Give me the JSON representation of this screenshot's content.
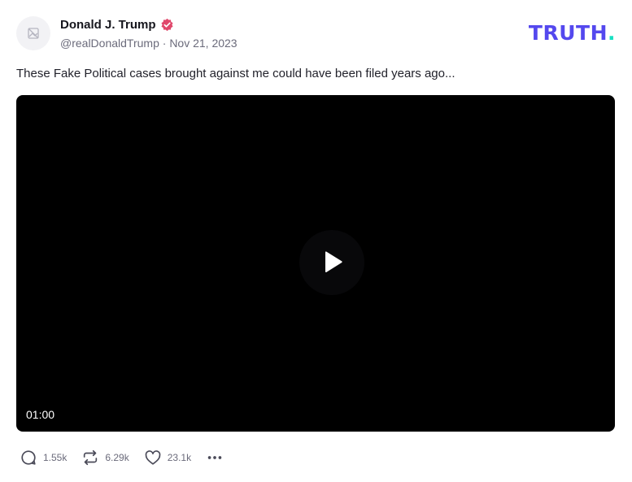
{
  "author": {
    "display_name": "Donald J. Trump",
    "handle": "@realDonaldTrump",
    "separator": "·",
    "date": "Nov 21, 2023"
  },
  "brand": {
    "wordmark": "TRUTH",
    "dot": ".",
    "primary_color": "#5448ee",
    "accent_color": "#17e0c2"
  },
  "post": {
    "text": "These Fake Political cases brought against me could have been filed years ago..."
  },
  "video": {
    "duration": "01:00"
  },
  "actions": {
    "replies": "1.55k",
    "retruths": "6.29k",
    "likes": "23.1k"
  },
  "icons": {
    "avatar_placeholder": "image-placeholder-icon",
    "verified": "verified-badge-icon",
    "play": "play-icon",
    "reply": "speech-bubble-icon",
    "retruth": "repost-arrows-icon",
    "like": "heart-icon",
    "more": "ellipsis-icon"
  }
}
